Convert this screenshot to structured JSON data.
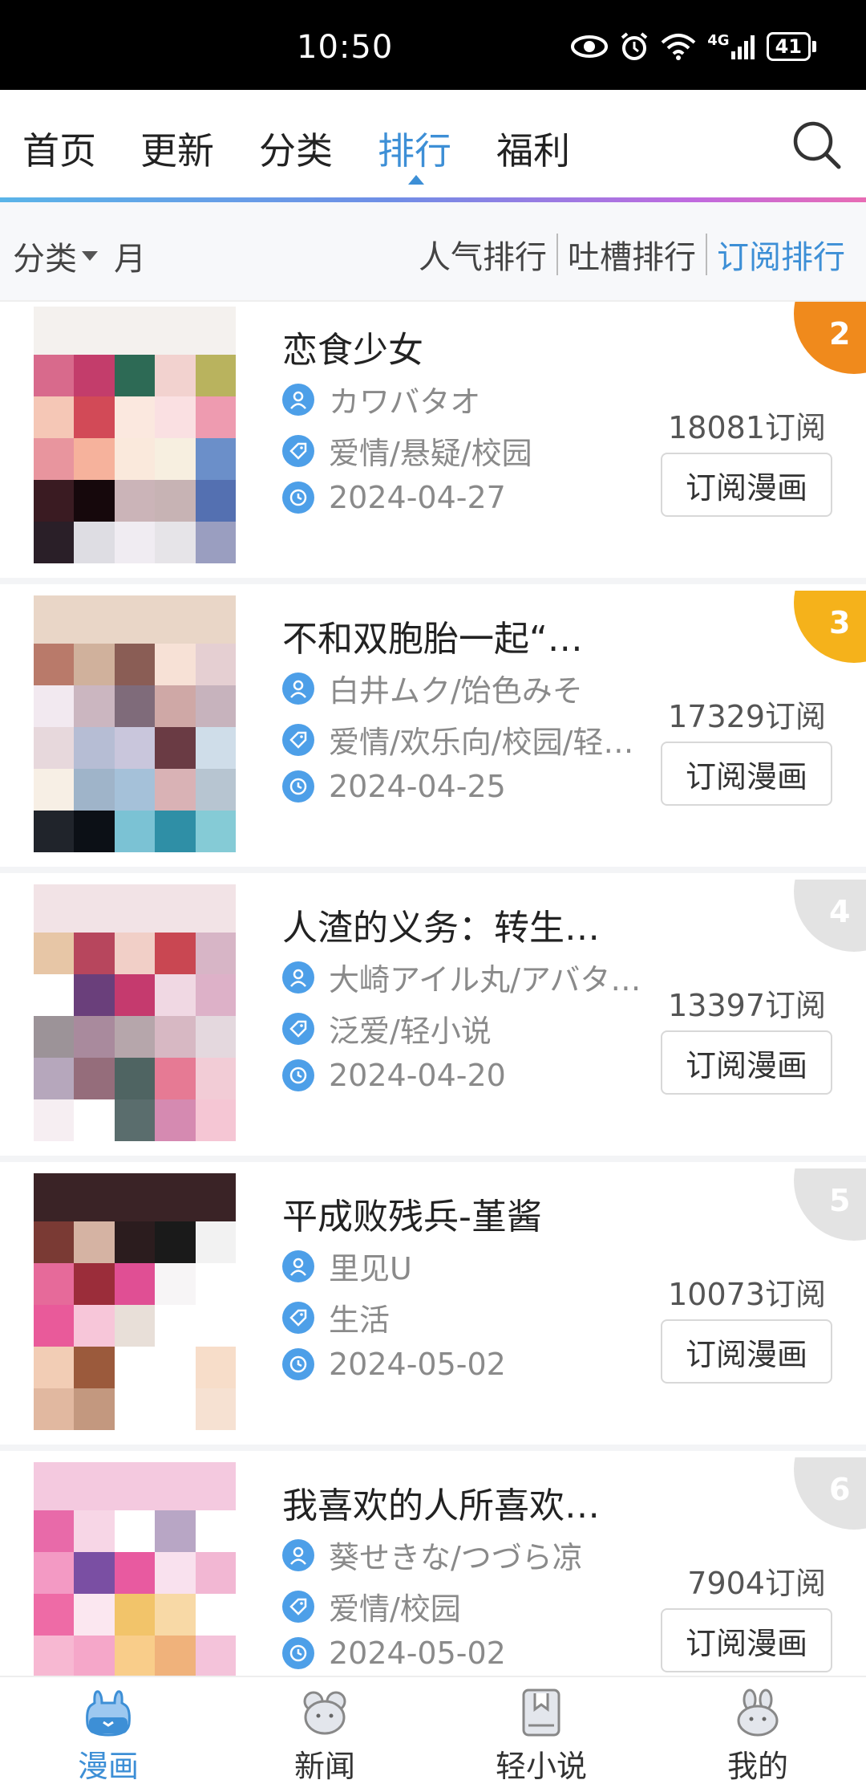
{
  "status_bar": {
    "time": "10:50",
    "network": "4G",
    "battery": "41",
    "icons": [
      "eye-icon",
      "alarm-icon",
      "wifi-icon",
      "signal-icon",
      "battery-icon"
    ]
  },
  "top_nav": {
    "tabs": [
      {
        "label": "首页",
        "active": false
      },
      {
        "label": "更新",
        "active": false
      },
      {
        "label": "分类",
        "active": false
      },
      {
        "label": "排行",
        "active": true
      },
      {
        "label": "福利",
        "active": false
      }
    ],
    "accent": "#3d8fd6"
  },
  "filter": {
    "category_label": "分类",
    "period_label": "月",
    "sort_tabs": [
      {
        "label": "人气排行",
        "active": false
      },
      {
        "label": "吐槽排行",
        "active": false
      },
      {
        "label": "订阅排行",
        "active": true
      }
    ]
  },
  "items": [
    {
      "rank": "2",
      "rank_color": "#f08a1c",
      "title": "恋食少女",
      "author": "カワバタオ",
      "tags": "爱情/悬疑/校园",
      "date": "2024-04-27",
      "subs": "18081订阅",
      "button": "订阅漫画"
    },
    {
      "rank": "3",
      "rank_color": "#f5b21b",
      "title": "不和双胞胎一起“…",
      "author": "白井ムク/饴色みそ",
      "tags": "爱情/欢乐向/校园/轻…",
      "date": "2024-04-25",
      "subs": "17329订阅",
      "button": "订阅漫画"
    },
    {
      "rank": "4",
      "rank_color": "#e3e3e3",
      "title": "人渣的义务：转生…",
      "author": "大崎アイル丸/アバタ…",
      "tags": "泛爱/轻小说",
      "date": "2024-04-20",
      "subs": "13397订阅",
      "button": "订阅漫画"
    },
    {
      "rank": "5",
      "rank_color": "#e3e3e3",
      "title": "平成败残兵-堇酱",
      "author": "里见U",
      "tags": "生活",
      "date": "2024-05-02",
      "subs": "10073订阅",
      "button": "订阅漫画"
    },
    {
      "rank": "6",
      "rank_color": "#e3e3e3",
      "title": "我喜欢的人所喜欢…",
      "author": "葵せきな/つづら凉",
      "tags": "爱情/校园",
      "date": "2024-05-02",
      "subs": "7904订阅",
      "button": "订阅漫画"
    }
  ],
  "bottom_nav": [
    {
      "label": "漫画",
      "icon": "rabbit-comic-icon",
      "active": true
    },
    {
      "label": "新闻",
      "icon": "mouse-news-icon",
      "active": false
    },
    {
      "label": "轻小说",
      "icon": "bookmark-novel-icon",
      "active": false
    },
    {
      "label": "我的",
      "icon": "bunny-profile-icon",
      "active": false
    }
  ]
}
